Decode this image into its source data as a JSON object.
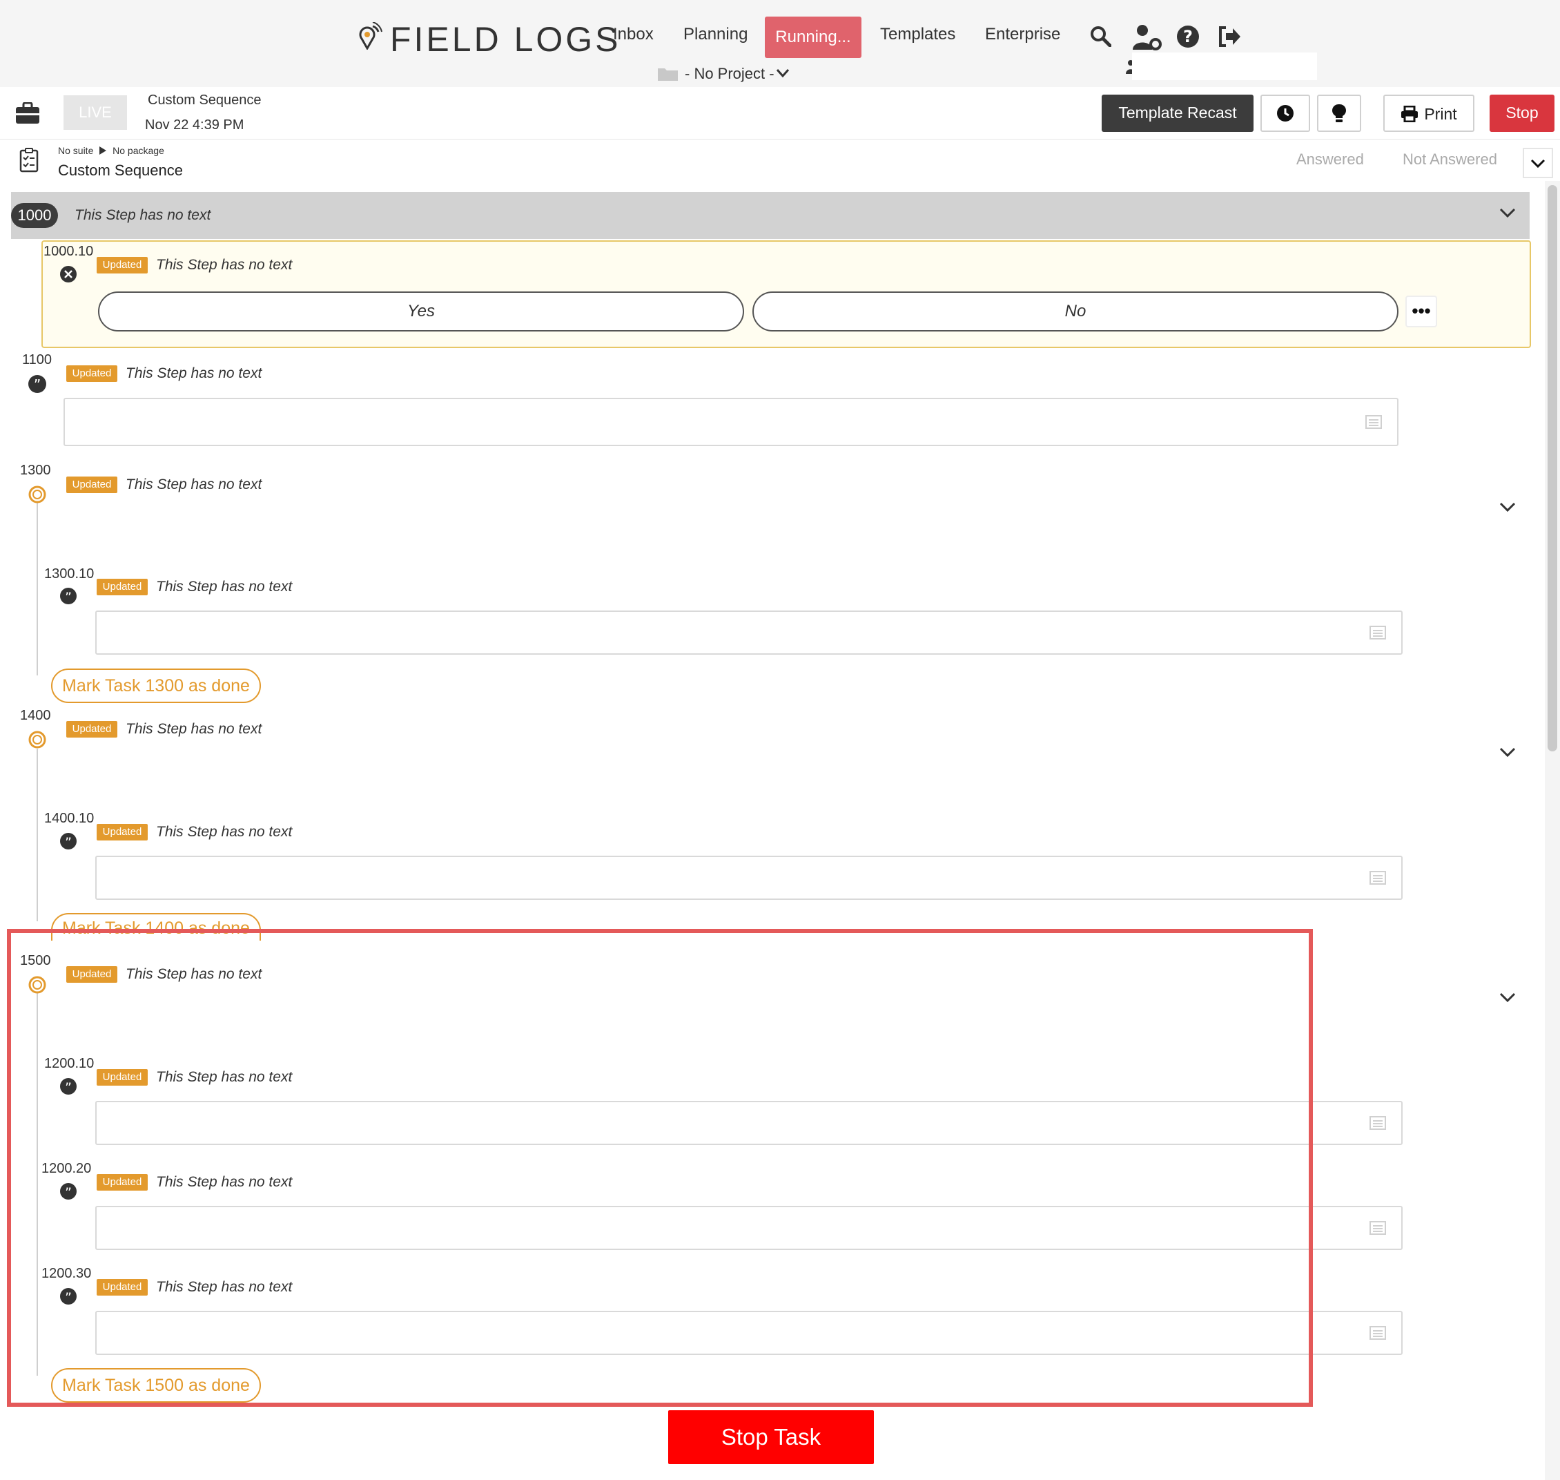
{
  "nav": {
    "brand": "FIELD LOGS",
    "links": [
      "Inbox",
      "Planning",
      "Running...",
      "Templates",
      "Enterprise"
    ],
    "project": "- No Project -"
  },
  "toolbar": {
    "live": "LIVE",
    "title": "Custom Sequence",
    "date": "Nov 22 4:39 PM",
    "recast": "Template Recast",
    "print": "Print",
    "stop": "Stop"
  },
  "breadcrumb": {
    "suite": "No suite",
    "package": "No package",
    "title": "Custom Sequence",
    "answered": "Answered",
    "not_answered": "Not Answered"
  },
  "badge": "Updated",
  "step_text": "This Step has no text",
  "steps": {
    "s1000": "1000",
    "s1000_10": "1000.10",
    "yes": "Yes",
    "no": "No",
    "s1100": "1100",
    "s1300": "1300",
    "s1300_10": "1300.10",
    "done1300": "Mark Task 1300 as done",
    "s1400": "1400",
    "s1400_10": "1400.10",
    "done1400": "Mark Task 1400 as done",
    "s1500": "1500",
    "s1200_10": "1200.10",
    "s1200_20": "1200.20",
    "s1200_30": "1200.30",
    "done1500": "Mark Task 1500 as done"
  },
  "stop_task": "Stop Task",
  "colors": {
    "accent_orange": "#e39a2d",
    "running_pink": "#e0636c",
    "stop_red": "#d9363e",
    "highlight_red": "#e45959"
  }
}
